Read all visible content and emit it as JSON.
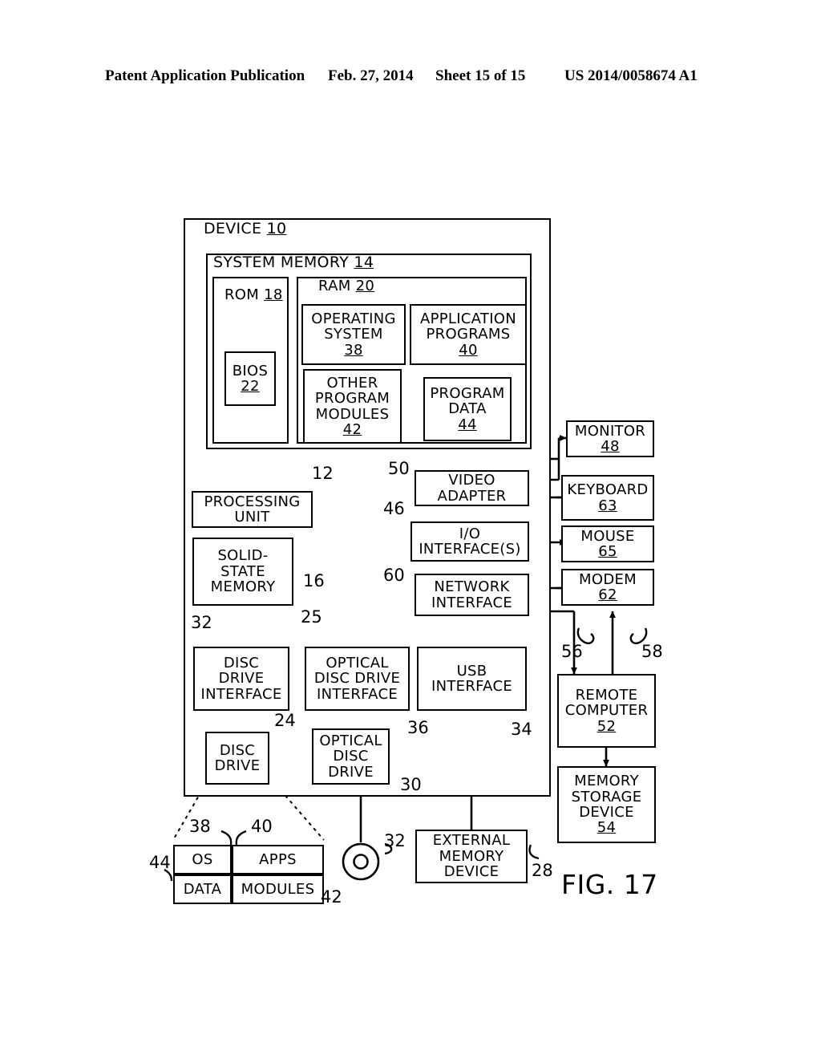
{
  "header": {
    "publication": "Patent Application Publication",
    "date": "Feb. 27, 2014",
    "sheet": "Sheet 15 of 15",
    "patent_number": "US 2014/0058674 A1"
  },
  "figure": {
    "label": "FIG. 17",
    "title": "DEVICE 10",
    "device_name": "DEVICE",
    "device_ref": "10"
  },
  "boxes": {
    "device": {
      "name": "DEVICE",
      "ref": "10"
    },
    "system_memory": {
      "name": "SYSTEM MEMORY",
      "ref": "14"
    },
    "rom": {
      "name": "ROM",
      "ref": "18"
    },
    "bios": {
      "name": "BIOS",
      "ref": "22"
    },
    "ram": {
      "name": "RAM",
      "ref": "20"
    },
    "operating_system": {
      "name": "OPERATING SYSTEM",
      "ref": "38"
    },
    "application_programs": {
      "name": "APPLICATION PROGRAMS",
      "ref": "40"
    },
    "other_program_modules": {
      "name": "OTHER PROGRAM MODULES",
      "ref": "42"
    },
    "program_data": {
      "name": "PROGRAM DATA",
      "ref": "44"
    },
    "processing_unit": {
      "name": "PROCESSING UNIT",
      "ref": ""
    },
    "solid_state_memory": {
      "name": "SOLID-STATE MEMORY",
      "ref": ""
    },
    "video_adapter": {
      "name": "VIDEO ADAPTER",
      "ref": ""
    },
    "io_interfaces": {
      "name": "I/O INTERFACE(S)",
      "ref": ""
    },
    "network_interface": {
      "name": "NETWORK INTERFACE",
      "ref": ""
    },
    "monitor": {
      "name": "MONITOR",
      "ref": "48"
    },
    "keyboard": {
      "name": "KEYBOARD",
      "ref": "63"
    },
    "mouse": {
      "name": "MOUSE",
      "ref": "65"
    },
    "modem": {
      "name": "MODEM",
      "ref": "62"
    },
    "remote_computer": {
      "name": "REMOTE COMPUTER",
      "ref": "52"
    },
    "memory_storage_device": {
      "name": "MEMORY STORAGE DEVICE",
      "ref": "54"
    },
    "disc_drive_interface": {
      "name": "DISC DRIVE INTERFACE",
      "ref": ""
    },
    "optical_disc_drive_interface": {
      "name": "OPTICAL DISC DRIVE INTERFACE",
      "ref": ""
    },
    "usb_interface": {
      "name": "USB INTERFACE",
      "ref": ""
    },
    "disc_drive": {
      "name": "DISC DRIVE",
      "ref": ""
    },
    "optical_disc_drive": {
      "name": "OPTICAL DISC DRIVE",
      "ref": ""
    },
    "external_memory_device": {
      "name": "EXTERNAL MEMORY DEVICE",
      "ref": ""
    },
    "media_os": {
      "name": "OS",
      "ref": ""
    },
    "media_apps": {
      "name": "APPS",
      "ref": ""
    },
    "media_data": {
      "name": "DATA",
      "ref": ""
    },
    "media_modules": {
      "name": "MODULES",
      "ref": ""
    }
  },
  "box_text": {
    "device_title": "DEVICE",
    "device_ref": "10",
    "system_memory_title": "SYSTEM MEMORY",
    "system_memory_ref": "14",
    "rom_title": "ROM",
    "rom_ref": "18",
    "ram_title": "RAM",
    "ram_ref": "20",
    "bios_l1": "BIOS",
    "bios_ref": "22",
    "os_l1": "OPERATING",
    "os_l2": "SYSTEM",
    "os_ref": "38",
    "apps_l1": "APPLICATION",
    "apps_l2": "PROGRAMS",
    "apps_ref": "40",
    "opm_l1": "OTHER",
    "opm_l2": "PROGRAM",
    "opm_l3": "MODULES",
    "opm_ref": "42",
    "pdata_l1": "PROGRAM",
    "pdata_l2": "DATA",
    "pdata_ref": "44",
    "pu_l1": "PROCESSING",
    "pu_l2": "UNIT",
    "ssm_l1": "SOLID-",
    "ssm_l2": "STATE",
    "ssm_l3": "MEMORY",
    "va_l1": "VIDEO",
    "va_l2": "ADAPTER",
    "io_l1": "I/O",
    "io_l2": "INTERFACE(S)",
    "ni_l1": "NETWORK",
    "ni_l2": "INTERFACE",
    "monitor_l1": "MONITOR",
    "monitor_ref": "48",
    "keyboard_l1": "KEYBOARD",
    "keyboard_ref": "63",
    "mouse_l1": "MOUSE",
    "mouse_ref": "65",
    "modem_l1": "MODEM",
    "modem_ref": "62",
    "remote_l1": "REMOTE",
    "remote_l2": "COMPUTER",
    "remote_ref": "52",
    "msd_l1": "MEMORY",
    "msd_l2": "STORAGE",
    "msd_l3": "DEVICE",
    "msd_ref": "54",
    "ddi_l1": "DISC",
    "ddi_l2": "DRIVE",
    "ddi_l3": "INTERFACE",
    "oddi_l1": "OPTICAL",
    "oddi_l2": "DISC DRIVE",
    "oddi_l3": "INTERFACE",
    "usb_l1": "USB",
    "usb_l2": "INTERFACE",
    "dd_l1": "DISC",
    "dd_l2": "DRIVE",
    "odd_l1": "OPTICAL",
    "odd_l2": "DISC",
    "odd_l3": "DRIVE",
    "emd_l1": "EXTERNAL",
    "emd_l2": "MEMORY",
    "emd_l3": "DEVICE",
    "media_os": "OS",
    "media_apps": "APPS",
    "media_data": "DATA",
    "media_modules": "MODULES"
  },
  "reference_numerals": {
    "n12": "12",
    "n16": "16",
    "n24": "24",
    "n25": "25",
    "n28": "28",
    "n30": "30",
    "n32_left": "32",
    "n32_disc": "32",
    "n34": "34",
    "n36": "36",
    "n38": "38",
    "n40": "40",
    "n42": "42",
    "n44": "44",
    "n46": "46",
    "n50": "50",
    "n56": "56",
    "n58": "58",
    "n60": "60"
  },
  "colors": {
    "ink": "#000000",
    "paper": "#ffffff"
  }
}
